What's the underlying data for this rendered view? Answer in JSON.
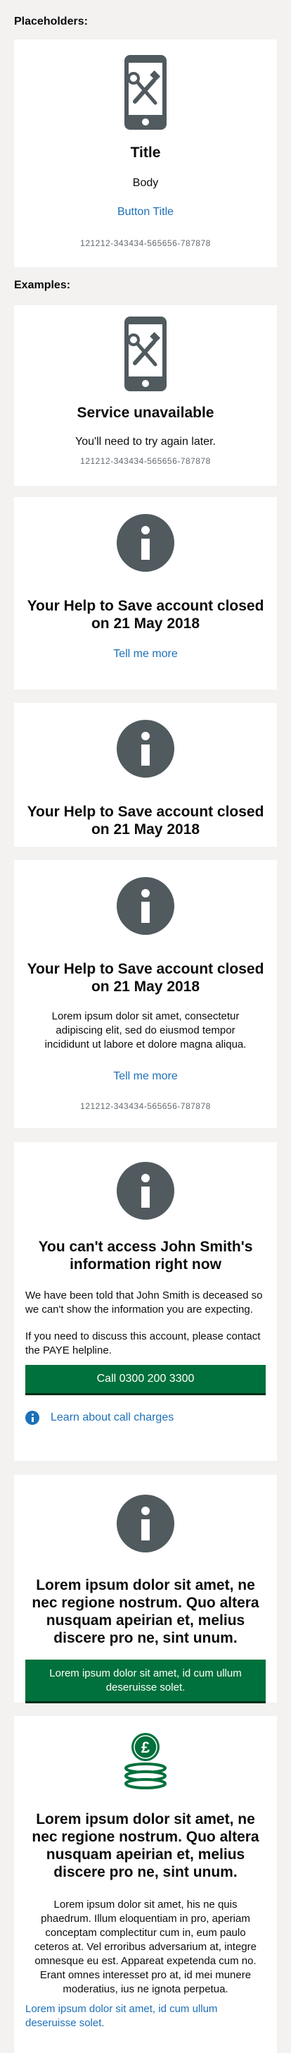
{
  "sections": {
    "placeholders_heading": "Placeholders:",
    "examples_heading": "Examples:"
  },
  "placeholder_card": {
    "icon": "broken-phone-icon",
    "title": "Title",
    "body": "Body",
    "button": "Button Title",
    "reference": "121212-343434-565656-787878"
  },
  "service_card": {
    "icon": "broken-phone-icon",
    "title": "Service unavailable",
    "body": "You'll need to try again later.",
    "reference": "121212-343434-565656-787878"
  },
  "closed_card_1": {
    "icon": "info-icon",
    "title": "Your Help to Save account closed on 21 May 2018",
    "link": "Tell me more"
  },
  "closed_card_2": {
    "icon": "info-icon",
    "title": "Your Help to Save account closed on 21 May 2018"
  },
  "closed_card_3": {
    "icon": "info-icon",
    "title": "Your Help to Save account closed on 21 May 2018",
    "body": "Lorem ipsum dolor sit amet, consectetur adipiscing elit, sed do eiusmod tempor incididunt ut labore et dolore magna aliqua.",
    "link": "Tell me more",
    "reference": "121212-343434-565656-787878"
  },
  "access_card": {
    "icon": "info-icon",
    "title": "You can't access John Smith's information right now",
    "paragraph_1": "We have been told that John Smith is deceased so we can't show the information you are expecting.",
    "paragraph_2": "If you need to discuss this account, please contact the PAYE helpline.",
    "button": "Call 0300 200 3300",
    "link": "Learn about call charges"
  },
  "lorem_card_1": {
    "icon": "info-icon",
    "title": "Lorem ipsum dolor sit amet, ne nec regione nostrum. Quo altera nusquam apeirian et, melius discere pro ne, sint unum.",
    "button": "Lorem ipsum dolor sit amet, id cum ullum deseruisse solet."
  },
  "lorem_card_2": {
    "icon": "pound-coins-icon",
    "title": "Lorem ipsum dolor sit amet, ne nec regione nostrum. Quo altera nusquam apeirian et, melius discere pro ne, sint unum.",
    "body": "Lorem ipsum dolor sit amet, his ne quis phaedrum. Illum eloquentiam in pro, aperiam conceptam complectitur cum in, eum paulo ceteros at. Vel erroribus adversarium at, integre omnesque eu est. Appareat expetenda cum no. Erant omnes interesset pro at, id mei munere moderatius, ius ne ignota perpetua.",
    "link": "Lorem ipsum dolor sit amet, id cum ullum deseruisse solet."
  },
  "colors": {
    "background": "#f3f2f1",
    "card": "#ffffff",
    "link": "#1d70b8",
    "green_button": "#00703c",
    "icon_grey": "#505a5f",
    "coins_green": "#00703c"
  }
}
